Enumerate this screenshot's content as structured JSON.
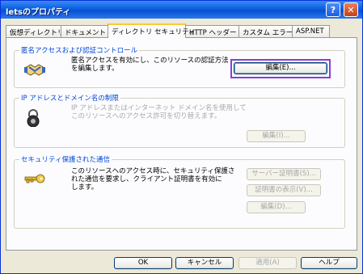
{
  "window": {
    "title": "letsのプロパティ",
    "help_glyph": "?",
    "close_glyph": "✕"
  },
  "tabs": [
    {
      "label": "仮想ディレクトリ"
    },
    {
      "label": "ドキュメント"
    },
    {
      "label": "ディレクトリ セキュリティ",
      "active": true
    },
    {
      "label": "HTTP ヘッダー"
    },
    {
      "label": "カスタム エラー"
    },
    {
      "label": "ASP.NET"
    }
  ],
  "anon": {
    "title": "匿名アクセスおよび認証コントロール",
    "desc": "匿名アクセスを有効にし、このリソースの認証方法\nを編集します。",
    "edit": "編集(E)...",
    "icon": "handshake-icon"
  },
  "ip": {
    "title": "IP アドレスとドメイン名の制限",
    "desc": "IP アドレスまたはインターネット ドメイン名を使用して\nこのリソースへのアクセス許可を切り替えます。",
    "edit": "編集(I)...",
    "icon": "lock-icon"
  },
  "secure": {
    "title": "セキュリティ保護された通信",
    "desc": "このリソースへのアクセス時に、セキュリティ保護さ\nれた通信を要求し、クライアント証明書を有効に\nします。",
    "server_cert": "サーバー証明書(S)...",
    "view_cert": "証明書の表示(V)...",
    "edit": "編集(D)...",
    "icon": "key-icon"
  },
  "footer": {
    "ok": "OK",
    "cancel": "キャンセル",
    "apply": "適用(A)",
    "help": "ヘルプ"
  },
  "colors": {
    "highlight": "#8b3dd6",
    "group_title": "#0046d5",
    "title_bar": "#0a5fe0"
  }
}
